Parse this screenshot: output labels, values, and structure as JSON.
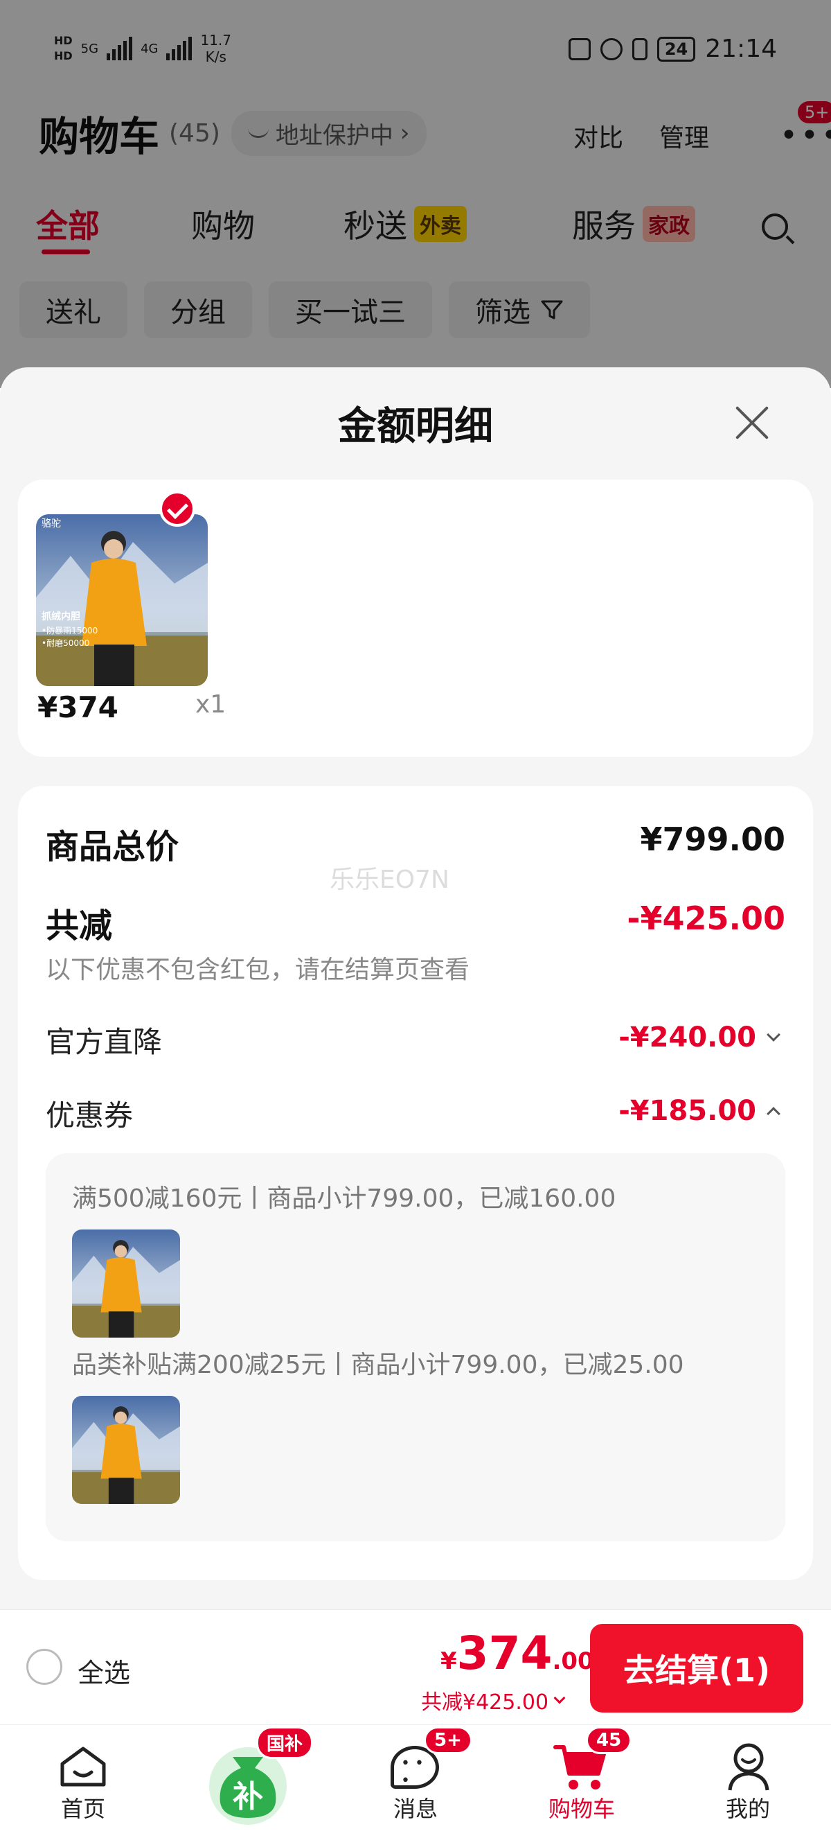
{
  "status_bar": {
    "hd1": "HD",
    "hd2": "HD",
    "net1": "5G",
    "net2": "4G",
    "speed_value": "11.7",
    "speed_unit": "K/s",
    "battery": "24",
    "time": "21:14"
  },
  "cart_header": {
    "title": "购物车",
    "count": "(45)",
    "address_pill": "地址保护中",
    "compare": "对比",
    "manage": "管理",
    "more_badge": "5+"
  },
  "tabs": [
    {
      "label": "全部"
    },
    {
      "label": "购物"
    },
    {
      "label": "秒送",
      "tag": "外卖"
    },
    {
      "label": "服务",
      "tag": "家政"
    }
  ],
  "chips": [
    "送礼",
    "分组",
    "买一试三",
    "筛选"
  ],
  "sheet": {
    "title": "金额明细",
    "item": {
      "price": "¥374",
      "qty": "x1",
      "thumb_brand": "骆驼",
      "thumb_line1": "抓绒内胆",
      "thumb_line2": "•防暴雨15000",
      "thumb_line3": "•耐磨50000"
    },
    "total_label": "商品总价",
    "total_value": "¥799.00",
    "watermark": "乐乐EO7N",
    "reduce_label": "共减",
    "reduce_value": "-¥425.00",
    "reduce_note": "以下优惠不包含红包，请在结算页查看",
    "official_label": "官方直降",
    "official_value": "-¥240.00",
    "coupon_label": "优惠券",
    "coupon_value": "-¥185.00",
    "coupons": [
      {
        "text": "满500减160元丨商品小计799.00，已减160.00"
      },
      {
        "text": "品类补贴满200减25元丨商品小计799.00，已减25.00"
      }
    ]
  },
  "checkout": {
    "select_all": "全选",
    "yen": "¥",
    "price_int": "374",
    "price_dec": ".00",
    "discount": "共减¥425.00",
    "button": "去结算(1)"
  },
  "nav": {
    "home": "首页",
    "subsidy_badge": "国补",
    "subsidy_char": "补",
    "messages": "消息",
    "messages_badge": "5+",
    "cart": "购物车",
    "cart_badge": "45",
    "me": "我的"
  },
  "colors": {
    "accent": "#e4002b",
    "checkout_button": "#f0112a",
    "subsidy_green": "#2fae4e"
  }
}
